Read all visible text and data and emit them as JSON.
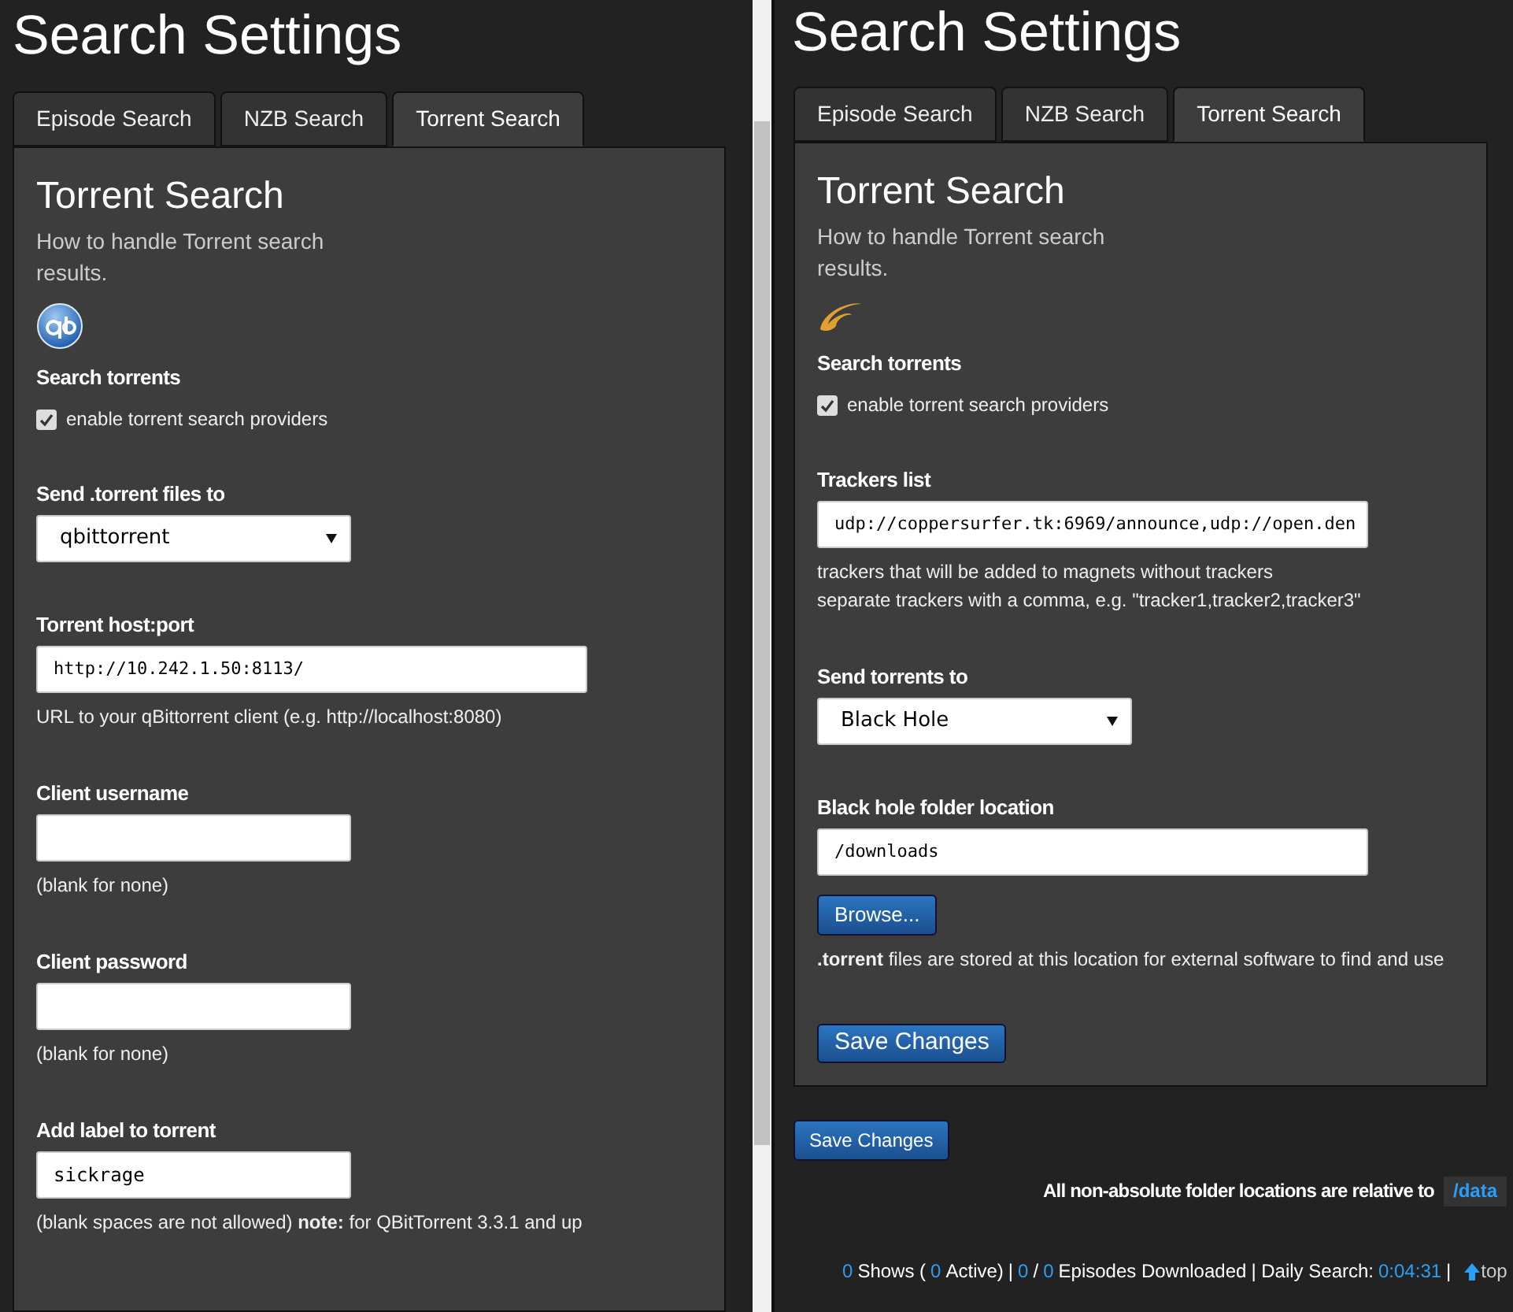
{
  "panels": [
    {
      "title": "Search Settings",
      "tabs": [
        {
          "label": "Episode Search",
          "selected": false
        },
        {
          "label": "NZB Search",
          "selected": false
        },
        {
          "label": "Torrent Search",
          "selected": true
        }
      ],
      "heading": "Torrent Search",
      "description": "How to handle Torrent search results.",
      "logo": {
        "kind": "qbittorrent"
      },
      "sections": [
        {
          "kind": "checkbox",
          "label": "Search torrents",
          "option": "enable torrent search providers",
          "checked": true
        },
        {
          "kind": "select",
          "label": "Send .torrent files to",
          "value": "qbittorrent"
        },
        {
          "kind": "wide-text",
          "label": "Torrent host:port",
          "value": "http://10.242.1.50:8113/",
          "notes": [
            "URL to your qBittorrent client (e.g. http://localhost:8080)"
          ]
        },
        {
          "kind": "text",
          "label": "Client username",
          "notes": [
            "(blank for none)"
          ]
        },
        {
          "kind": "text",
          "label": "Client password",
          "notes": [
            "(blank for none)"
          ]
        },
        {
          "kind": "text",
          "label": "Add label to torrent",
          "value": "sickrage",
          "notes": [
            "(blank spaces are not allowed) **note:** for QBitTorrent 3.3.1 and up"
          ]
        }
      ]
    },
    {
      "title": "Search Settings",
      "tabs": [
        {
          "label": "Episode Search",
          "selected": false
        },
        {
          "label": "NZB Search",
          "selected": false
        },
        {
          "label": "Torrent Search",
          "selected": true
        }
      ],
      "heading": "Torrent Search",
      "description": "How to handle Torrent search results.",
      "logo": {
        "kind": "blackhole"
      },
      "sections": [
        {
          "kind": "checkbox",
          "label": "Search torrents",
          "option": "enable torrent search providers",
          "checked": true
        },
        {
          "kind": "wide-text",
          "label": "Trackers list",
          "value": "udp://coppersurfer.tk:6969/announce,udp://open.den",
          "notes": [
            "trackers that will be added to magnets without trackers",
            "separate trackers with a comma, e.g. \"tracker1,tracker2,tracker3\""
          ]
        },
        {
          "kind": "select",
          "label": "Send torrents to",
          "value": "Black Hole"
        },
        {
          "kind": "wide-text",
          "label": "Black hole folder location",
          "value": "/downloads",
          "button": "Browse...",
          "notes": [
            "**.torrent** files are stored at this location for external software to find and use"
          ]
        }
      ],
      "panel_button": "Save Changes",
      "save_button": "Save Changes",
      "relative_note": {
        "text": "All non-absolute folder locations are relative to",
        "path": "/data"
      },
      "footer": [
        {
          "kind": "count",
          "text": "0"
        },
        {
          "kind": "label",
          "text": "Shows ("
        },
        {
          "kind": "count",
          "text": "0"
        },
        {
          "kind": "label",
          "text": "Active)"
        },
        {
          "kind": "label",
          "text": "|"
        },
        {
          "kind": "count",
          "text": "0"
        },
        {
          "kind": "label",
          "text": "/"
        },
        {
          "kind": "count",
          "text": "0"
        },
        {
          "kind": "label",
          "text": "Episodes Downloaded"
        },
        {
          "kind": "label",
          "text": "| Daily Search:"
        },
        {
          "kind": "count",
          "text": "0:04:31"
        },
        {
          "kind": "label",
          "text": "|"
        }
      ],
      "top_link": "top"
    }
  ]
}
